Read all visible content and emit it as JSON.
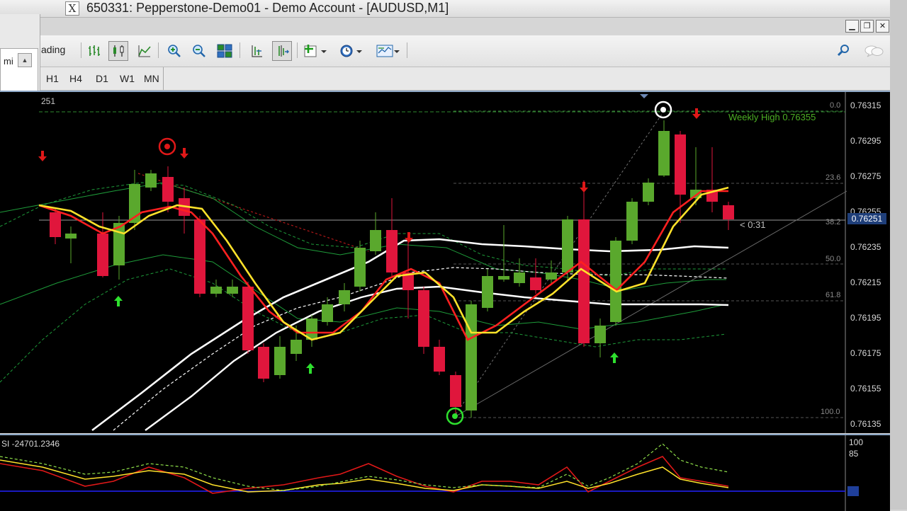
{
  "window": {
    "title": "650331: Pepperstone-Demo01 - Demo Account - [AUDUSD,M1]",
    "controls": [
      "▁",
      "❐",
      "✕"
    ]
  },
  "toolbar": {
    "trading_label": "ading",
    "buttons": [
      "bar-chart-icon",
      "candlestick-icon",
      "line-chart-icon",
      "zoom-in-icon",
      "zoom-out-icon",
      "tile-windows-icon",
      "chart-shift-icon",
      "autoscroll-icon",
      "indicators-icon",
      "periods-icon",
      "templates-icon",
      "search-icon",
      "chat-icon"
    ]
  },
  "timeframes": [
    "H1",
    "H4",
    "D1",
    "W1",
    "MN"
  ],
  "left_panel": {
    "label": "mi",
    "rows": [
      "..",
      "..",
      "..",
      ".."
    ]
  },
  "chart": {
    "top_left_value": "251",
    "price_labels": [
      "0.76315",
      "0.76295",
      "0.76275",
      "0.76255",
      "0.76235",
      "0.76215",
      "0.76195",
      "0.76175",
      "0.76155",
      "0.76135"
    ],
    "current_price": "0.76251",
    "countdown": "< 0:31",
    "weekly_label": "Weekly High 0.76355",
    "fib_levels": [
      "0.0",
      "23.6",
      "38.2",
      "50.0",
      "61.8",
      "100.0"
    ],
    "colors": {
      "bull": "#5aa82d",
      "bear": "#e0163c",
      "ema_red": "#ff2020",
      "ema_yellow": "#ffe22a",
      "band_white": "#ffffff",
      "band_green": "#1e9c3a"
    }
  },
  "oscillator": {
    "label": "SI -24701.2346",
    "levels": [
      "100",
      "85"
    ]
  }
}
